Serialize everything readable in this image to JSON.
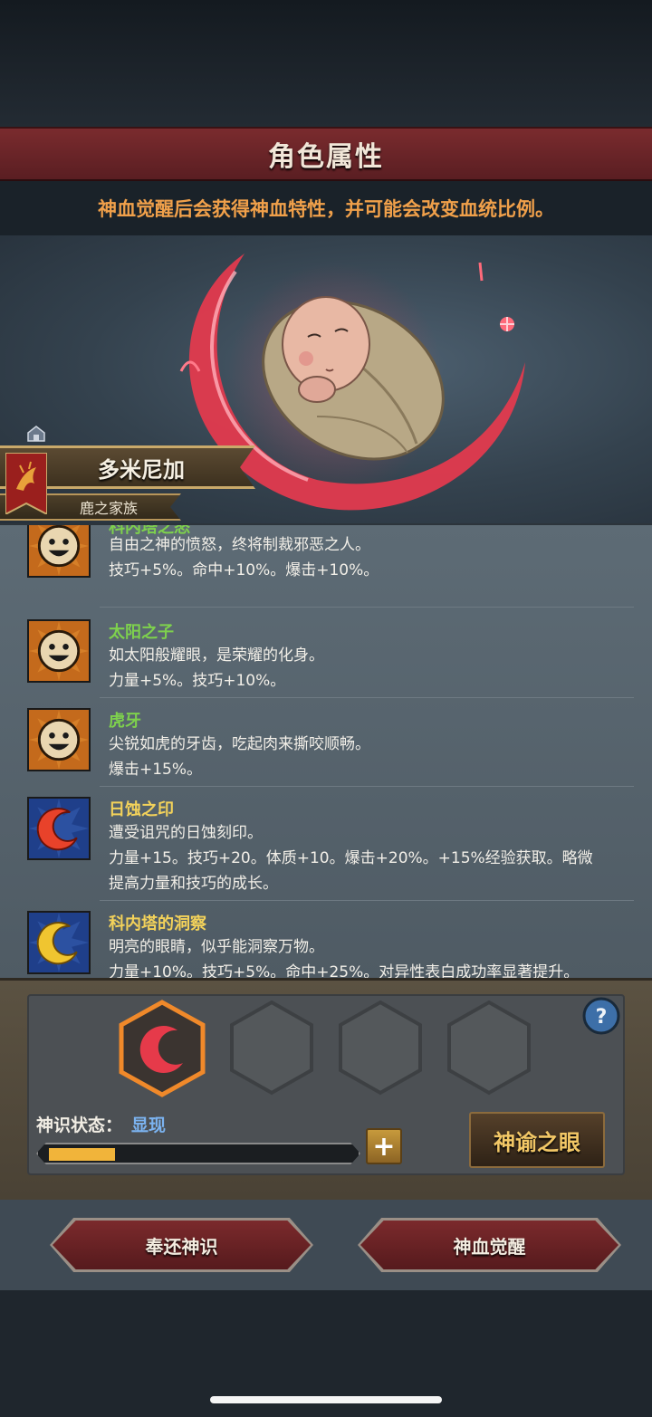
{
  "header": {
    "title": "角色属性",
    "subtitle": "神血觉醒后会获得神血特性，并可能会改变血统比例。"
  },
  "character": {
    "name": "多米尼加",
    "family": "鹿之家族"
  },
  "traits": [
    {
      "name": "科内塔之怒",
      "name_color": "green",
      "desc": "自由之神的愤怒，终将制裁邪恶之人。",
      "effect": "技巧+5%。命中+10%。爆击+10%。",
      "icon": "smiley-face-icon"
    },
    {
      "name": "太阳之子",
      "name_color": "green",
      "desc": "如太阳般耀眼，是荣耀的化身。",
      "effect": "力量+5%。技巧+10%。",
      "icon": "smiley-face-icon"
    },
    {
      "name": "虎牙",
      "name_color": "green",
      "desc": "尖锐如虎的牙齿，吃起肉来撕咬顺畅。",
      "effect": "爆击+15%。",
      "icon": "smiley-face-icon"
    },
    {
      "name": "日蚀之印",
      "name_color": "gold",
      "desc": "遭受诅咒的日蚀刻印。",
      "effect": "力量+15。技巧+20。体质+10。爆击+20%。+15%经验获取。略微",
      "effect2": "提高力量和技巧的成长。",
      "icon": "red-crescent-icon"
    },
    {
      "name": "科内塔的洞察",
      "name_color": "gold",
      "desc": "明亮的眼睛，似乎能洞察万物。",
      "effect": "力量+10%。技巧+5%。命中+25%。对异性表白成功率显著提升。",
      "icon": "gold-crescent-icon"
    }
  ],
  "divine_sense": {
    "status_label": "神识状态：",
    "status_value": "显现",
    "progress": 0.22,
    "plus_label": "+",
    "oracle_button": "神谕之眼",
    "help_label": "?"
  },
  "actions": {
    "return_button": "奉还神识",
    "awaken_button": "神血觉醒"
  },
  "colors": {
    "green": "#7ed14d",
    "gold": "#f3d25a",
    "accent_red": "#7b2a2c"
  }
}
